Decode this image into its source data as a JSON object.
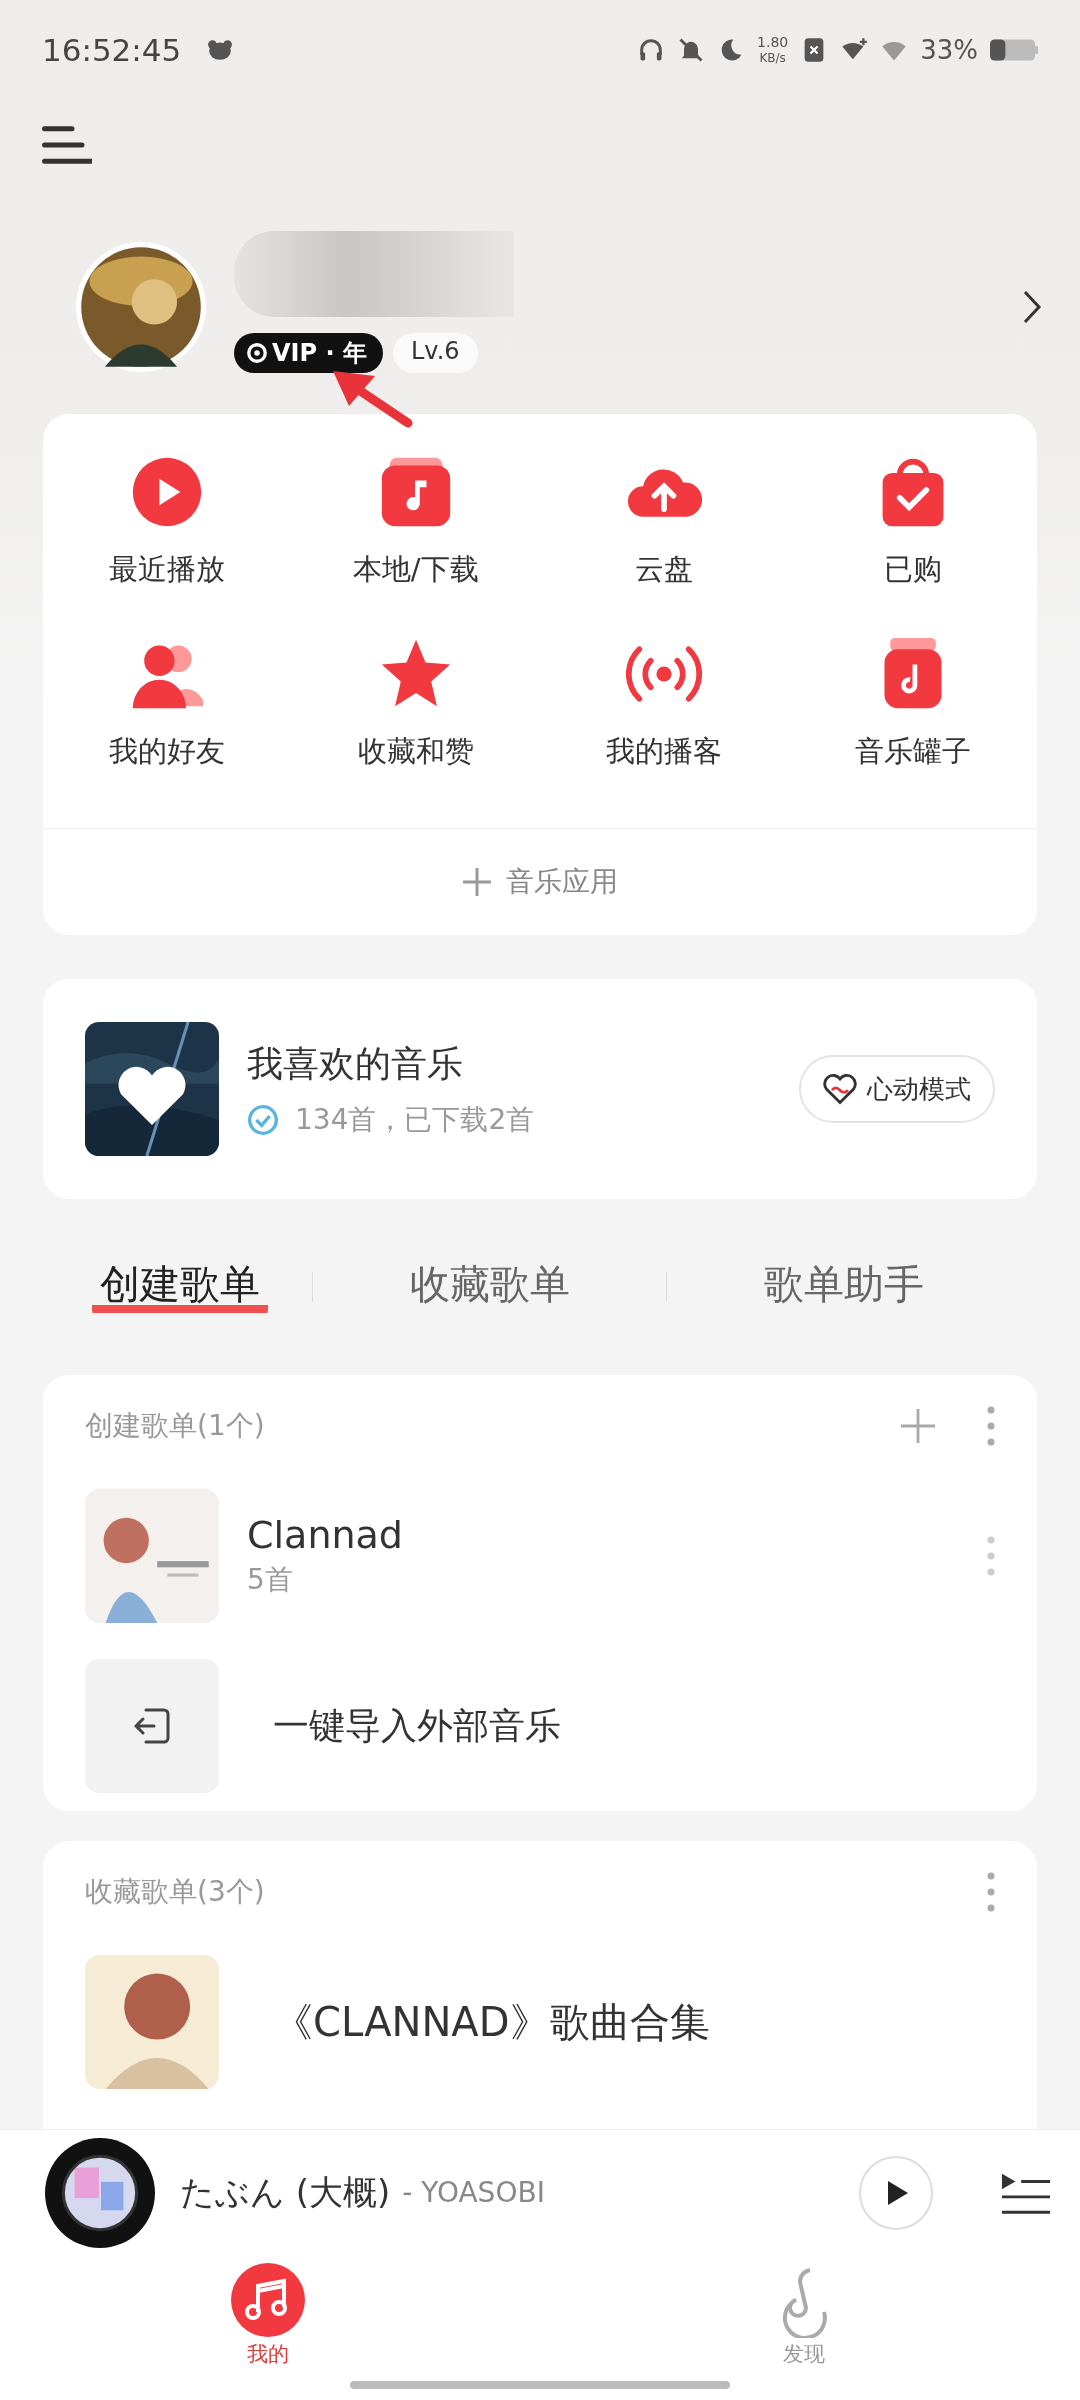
{
  "status_bar": {
    "time": "16:52:45",
    "speed_value": "1.80",
    "speed_unit": "KB/s",
    "battery": "33%"
  },
  "profile": {
    "vip": "VIP · 年",
    "level": "Lv.6"
  },
  "shortcuts": [
    {
      "kind": "recent",
      "label": "最近播放"
    },
    {
      "kind": "local",
      "label": "本地/下载"
    },
    {
      "kind": "cloud",
      "label": "云盘"
    },
    {
      "kind": "purchased",
      "label": "已购"
    },
    {
      "kind": "friends",
      "label": "我的好友"
    },
    {
      "kind": "favorites",
      "label": "收藏和赞"
    },
    {
      "kind": "podcast",
      "label": "我的播客"
    },
    {
      "kind": "jar",
      "label": "音乐罐子"
    }
  ],
  "music_apps": "音乐应用",
  "liked": {
    "title": "我喜欢的音乐",
    "subtitle": "134首，已下载2首",
    "mode_button": "心动模式"
  },
  "tabs": [
    {
      "label": "创建歌单",
      "selected": true
    },
    {
      "label": "收藏歌单",
      "selected": false
    },
    {
      "label": "歌单助手",
      "selected": false
    }
  ],
  "created": {
    "header": "创建歌单(1个)",
    "playlists": [
      {
        "title": "Clannad",
        "count": "5首"
      }
    ],
    "import": "一键导入外部音乐"
  },
  "collected": {
    "header": "收藏歌单(3个)",
    "playlists": [
      {
        "title": "《CLANNAD》歌曲合集"
      }
    ]
  },
  "player": {
    "title": "たぶん (大概)",
    "artist": "- YOASOBI"
  },
  "nav": [
    {
      "label": "我的",
      "selected": true
    },
    {
      "label": "发现",
      "selected": false
    }
  ]
}
